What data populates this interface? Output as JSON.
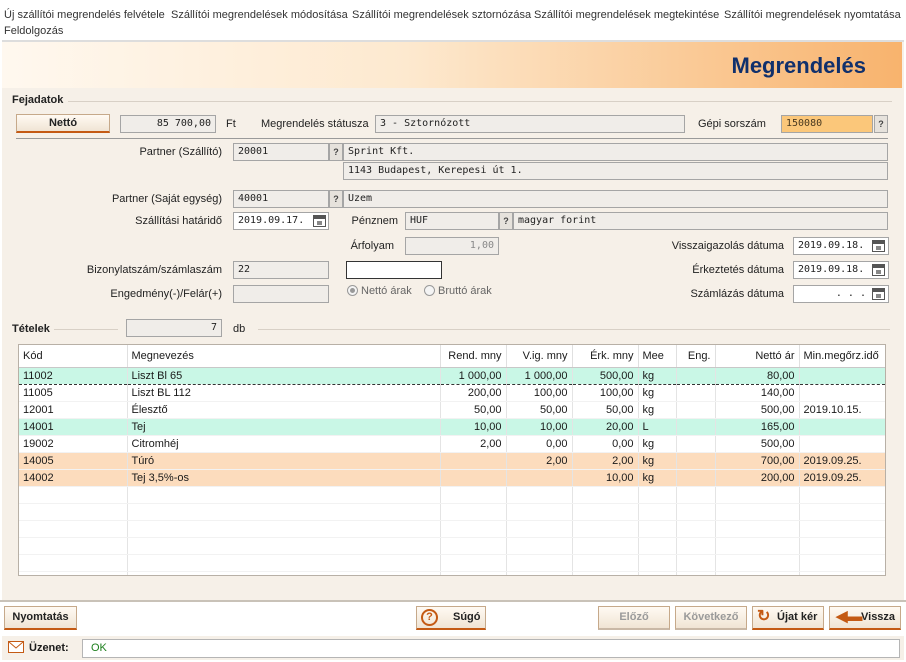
{
  "menu": {
    "items": [
      "Új szállítói megrendelés felvétele",
      "Szállítói megrendelések módosítása",
      "Szállítói megrendelések sztornózása",
      "Szállítói megrendelések megtekintése",
      "Szállítói megrendelések nyomtatása",
      "Feldolgozás"
    ]
  },
  "page_title": "Megrendelés",
  "header": {
    "section_label": "Fejadatok",
    "netto_button": "Nettó",
    "amount": "85 700,00",
    "currency_unit": "Ft",
    "status_label": "Megrendelés státusza",
    "status_value": "3 - Sztornózott",
    "machine_no_label": "Gépi sorszám",
    "machine_no_value": "150080",
    "partner_supplier_label": "Partner (Szállító)",
    "partner_supplier_code": "20001",
    "partner_supplier_name": "Sprint Kft.",
    "partner_supplier_address": "1143 Budapest, Kerepesi út 1.",
    "partner_own_label": "Partner (Saját egység)",
    "partner_own_code": "40001",
    "partner_own_name": "Uzem",
    "delivery_deadline_label": "Szállítási határidő",
    "delivery_deadline_value": "2019.09.17.",
    "currency_label": "Pénznem",
    "currency_code": "HUF",
    "currency_name": "magyar forint",
    "rate_label": "Árfolyam",
    "rate_value": "1,00",
    "confirm_date_label": "Visszaigazolás dátuma",
    "confirm_date_value": "2019.09.18.",
    "arrival_date_label": "Érkeztetés dátuma",
    "arrival_date_value": "2019.09.18.",
    "invoice_date_label": "Számlázás dátuma",
    "invoice_date_value": ".   .   .",
    "doc_no_label": "Bizonylatszám/számlaszám",
    "doc_no_value": "22",
    "discount_label": "Engedmény(-)/Felár(+)",
    "discount_value": "",
    "radio_net": "Nettó árak",
    "radio_gross": "Bruttó árak"
  },
  "items_section": {
    "label": "Tételek",
    "count": "7",
    "count_unit": "db"
  },
  "table": {
    "columns": [
      "Kód",
      "Megnevezés",
      "Rend. mny",
      "V.ig. mny",
      "Érk. mny",
      "Mee",
      "Eng.",
      "Nettó ár",
      "Min.megőrz.idő"
    ],
    "rows": [
      {
        "kod": "11002",
        "nev": "Liszt Bl 65",
        "rend": "1 000,00",
        "vig": "1 000,00",
        "erk": "500,00",
        "mee": "kg",
        "eng": "",
        "netto": "80,00",
        "min": ""
      },
      {
        "kod": "11005",
        "nev": "Liszt BL 112",
        "rend": "200,00",
        "vig": "100,00",
        "erk": "100,00",
        "mee": "kg",
        "eng": "",
        "netto": "140,00",
        "min": ""
      },
      {
        "kod": "12001",
        "nev": "Élesztő",
        "rend": "50,00",
        "vig": "50,00",
        "erk": "50,00",
        "mee": "kg",
        "eng": "",
        "netto": "500,00",
        "min": "2019.10.15."
      },
      {
        "kod": "14001",
        "nev": "Tej",
        "rend": "10,00",
        "vig": "10,00",
        "erk": "20,00",
        "mee": "L",
        "eng": "",
        "netto": "165,00",
        "min": ""
      },
      {
        "kod": "19002",
        "nev": "Citromhéj",
        "rend": "2,00",
        "vig": "0,00",
        "erk": "0,00",
        "mee": "kg",
        "eng": "",
        "netto": "500,00",
        "min": ""
      },
      {
        "kod": "14005",
        "nev": "Túró",
        "rend": "",
        "vig": "2,00",
        "erk": "2,00",
        "mee": "kg",
        "eng": "",
        "netto": "700,00",
        "min": "2019.09.25."
      },
      {
        "kod": "14002",
        "nev": "Tej 3,5%-os",
        "rend": "",
        "vig": "",
        "erk": "10,00",
        "mee": "kg",
        "eng": "",
        "netto": "200,00",
        "min": "2019.09.25."
      }
    ]
  },
  "buttons": {
    "print": "Nyomtatás",
    "help": "Súgó",
    "prev": "Előző",
    "next": "Következő",
    "new_request": "Újat kér",
    "back": "Vissza"
  },
  "status": {
    "label": "Üzenet:",
    "message": "OK"
  },
  "colors": {
    "title": "#10306c",
    "accent": "#c45a14",
    "row_green": "#c9f7e6",
    "row_orange": "#fcdcbd",
    "machine_no_bg": "#fbc77a",
    "ok_text": "#1d7f1d"
  }
}
